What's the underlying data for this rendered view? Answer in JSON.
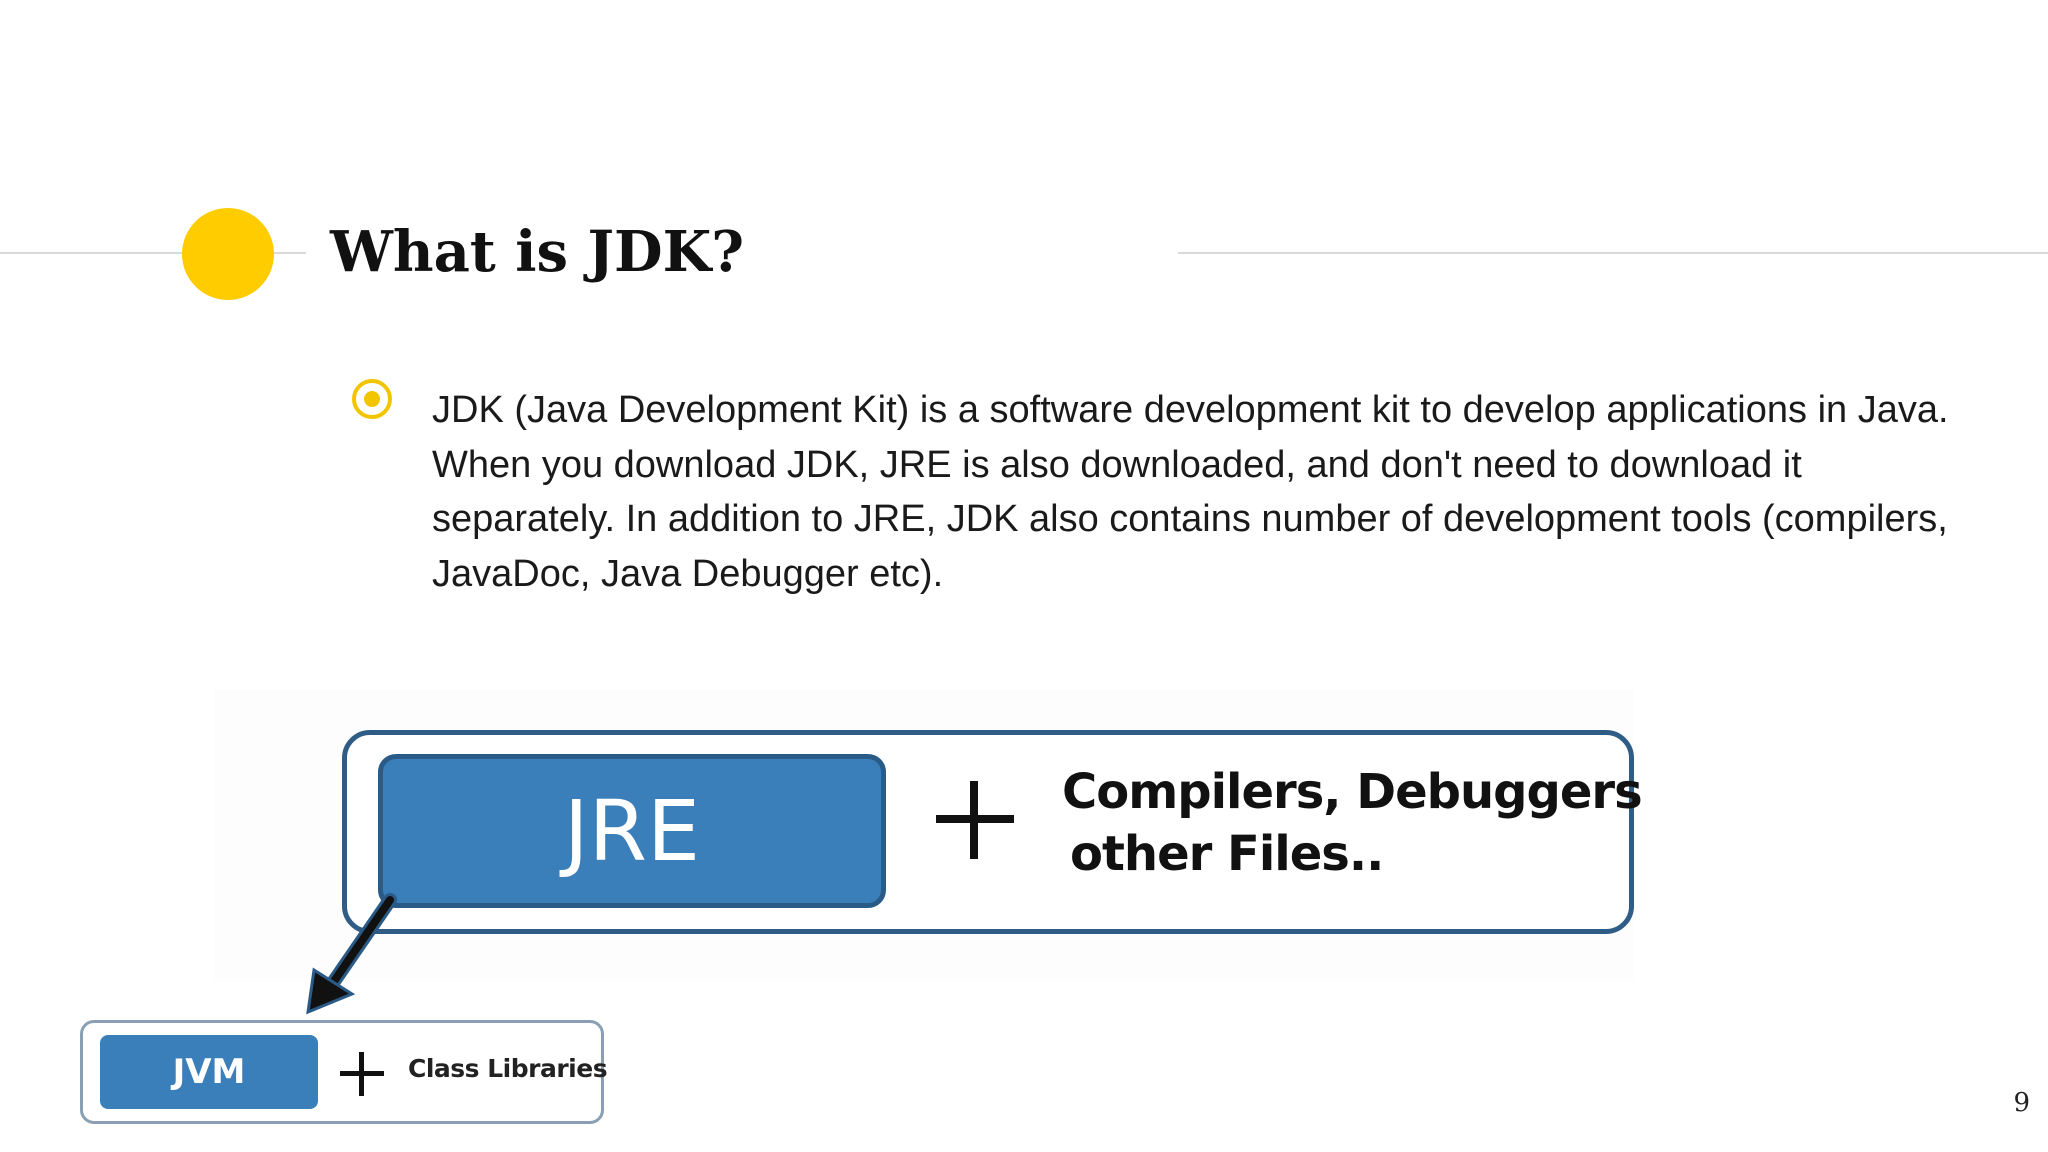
{
  "slide": {
    "title": "What is JDK?",
    "bullet": "JDK (Java Development Kit) is a software development kit to develop applications in Java. When you download JDK, JRE is also downloaded, and don't need to download it separately. In addition to JRE, JDK also contains number of development tools (compilers, JavaDoc, Java Debugger etc).",
    "page_number": "9"
  },
  "diagram": {
    "jre_label": "JRE",
    "compilers_line1": "Compilers, Debuggers",
    "compilers_line2": "other Files..",
    "jvm_label": "JVM",
    "class_libraries_label": "Class Libraries"
  },
  "colors": {
    "accent_yellow": "#ffcc00",
    "box_blue": "#3b7fba",
    "border_navy": "#2f5d86"
  }
}
